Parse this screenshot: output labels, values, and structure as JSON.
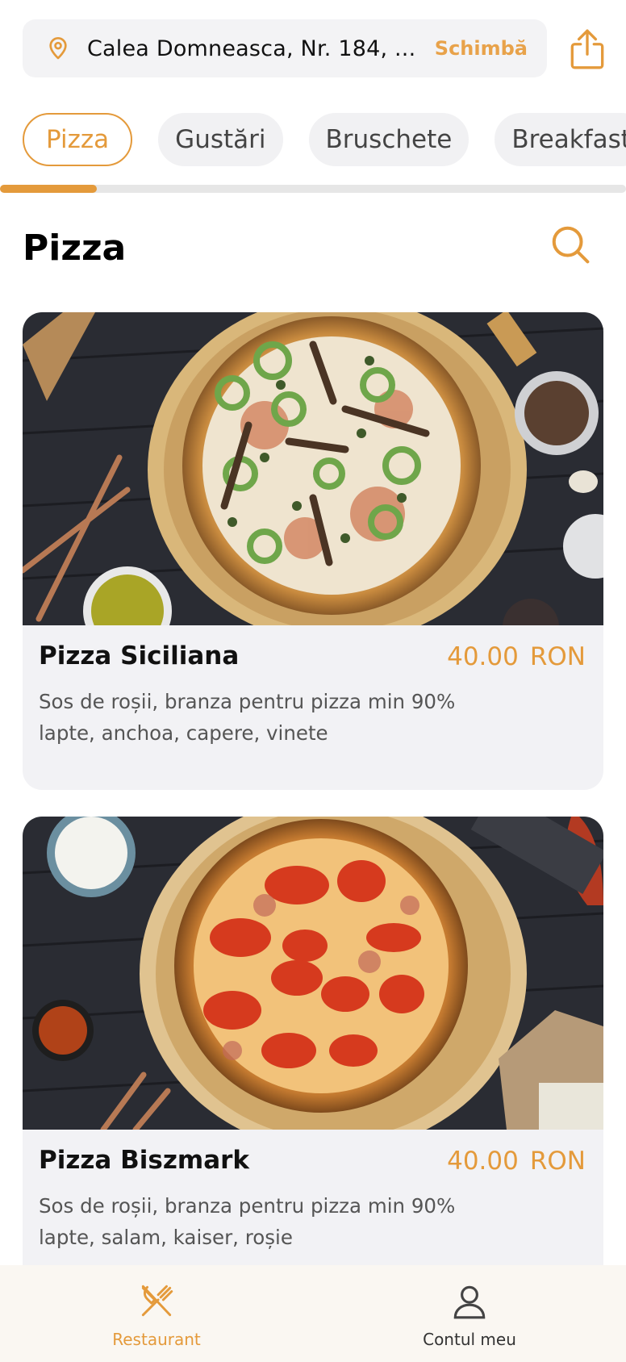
{
  "header": {
    "address": "Calea Domneasca, Nr. 184, ...",
    "change_label": "Schimbă"
  },
  "categories": [
    "Pizza",
    "Gustări",
    "Bruschete",
    "Breakfast"
  ],
  "active_category": "Pizza",
  "section": {
    "title": "Pizza"
  },
  "products": [
    {
      "name": "Pizza Siciliana",
      "price": "40.00",
      "currency": "RON",
      "description": "Sos de roșii, branza pentru pizza min 90% lapte, anchoa, capere, vinete"
    },
    {
      "name": "Pizza Biszmark",
      "price": "40.00",
      "currency": "RON",
      "description": "Sos de roșii, branza pentru pizza min 90% lapte, salam, kaiser, roșie"
    }
  ],
  "bottom_nav": {
    "restaurant_label": "Restaurant",
    "account_label": "Contul meu"
  },
  "colors": {
    "accent": "#e49a3b",
    "card_bg": "#f2f2f5",
    "nav_bg": "#faf7f2"
  },
  "icons": [
    "location-pin-icon",
    "share-icon",
    "search-icon",
    "cutlery-icon",
    "user-icon"
  ]
}
